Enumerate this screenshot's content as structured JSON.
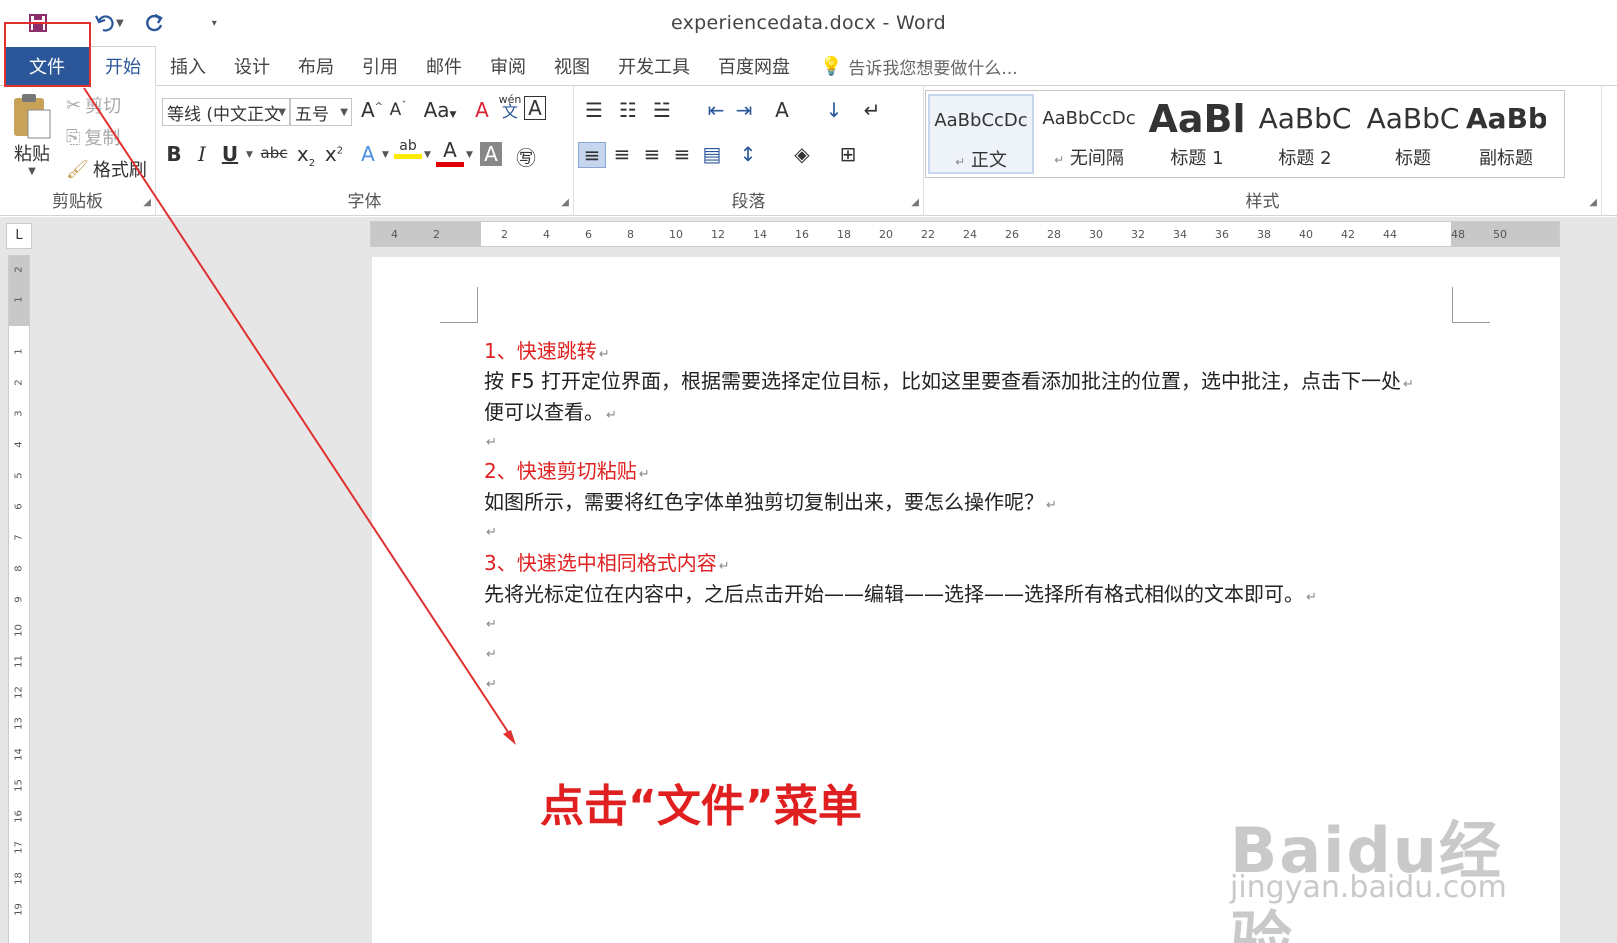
{
  "window": {
    "title": "experiencedata.docx - Word"
  },
  "qat": {
    "save_icon": "save-icon",
    "undo_icon": "undo-icon",
    "redo_icon": "redo-icon"
  },
  "tabs": [
    {
      "label": "文件"
    },
    {
      "label": "开始"
    },
    {
      "label": "插入"
    },
    {
      "label": "设计"
    },
    {
      "label": "布局"
    },
    {
      "label": "引用"
    },
    {
      "label": "邮件"
    },
    {
      "label": "审阅"
    },
    {
      "label": "视图"
    },
    {
      "label": "开发工具"
    },
    {
      "label": "百度网盘"
    }
  ],
  "tellme": {
    "placeholder": "告诉我您想要做什么..."
  },
  "clipboard": {
    "paste": "粘贴",
    "cut": "剪切",
    "copy": "复制",
    "format_painter": "格式刷",
    "label": "剪贴板"
  },
  "font": {
    "name": "等线 (中文正文",
    "size": "五号",
    "label": "字体",
    "case_label": "Aa",
    "phonetic": "wén",
    "phonetic_char": "文"
  },
  "paragraph": {
    "label": "段落"
  },
  "styles": {
    "label": "样式",
    "items": [
      {
        "sample": "AaBbCcDc",
        "name": "正文",
        "prefix": "↵"
      },
      {
        "sample": "AaBbCcDc",
        "name": "无间隔",
        "prefix": "↵"
      },
      {
        "sample": "AaBl",
        "name": "标题 1",
        "prefix": ""
      },
      {
        "sample": "AaBbC",
        "name": "标题 2",
        "prefix": ""
      },
      {
        "sample": "AaBbC",
        "name": "标题",
        "prefix": ""
      },
      {
        "sample": "AaBbC",
        "name": "副标题",
        "prefix": ""
      }
    ]
  },
  "ruler": {
    "h_ticks": [
      "4",
      "2",
      "2",
      "4",
      "6",
      "8",
      "10",
      "12",
      "14",
      "16",
      "18",
      "20",
      "22",
      "24",
      "26",
      "28",
      "30",
      "32",
      "34",
      "36",
      "38",
      "40",
      "42",
      "44",
      "48",
      "50"
    ],
    "v_ticks": [
      "2",
      "1",
      "1",
      "2",
      "3",
      "4",
      "5",
      "6",
      "7",
      "8",
      "9",
      "10",
      "11",
      "12",
      "13",
      "14",
      "15",
      "16",
      "17",
      "18",
      "19"
    ],
    "corner": "L"
  },
  "document": {
    "paragraphs": [
      {
        "text": "1、快速跳转",
        "heading": true
      },
      {
        "text": "按 F5 打开定位界面，根据需要选择定位目标，比如这里要查看添加批注的位置，选中批注，点击下一处",
        "heading": false
      },
      {
        "text": "便可以查看。",
        "heading": false
      },
      {
        "text": "",
        "heading": false
      },
      {
        "text": "2、快速剪切粘贴",
        "heading": true
      },
      {
        "text": "如图所示，需要将红色字体单独剪切复制出来，要怎么操作呢？",
        "heading": false
      },
      {
        "text": "",
        "heading": false
      },
      {
        "text": "3、快速选中相同格式内容",
        "heading": true
      },
      {
        "text": "先将光标定位在内容中，之后点击开始——编辑——选择——选择所有格式相似的文本即可。",
        "heading": false
      },
      {
        "text": "",
        "heading": false
      },
      {
        "text": "",
        "heading": false
      },
      {
        "text": "",
        "heading": false
      }
    ],
    "para_mark": "↵"
  },
  "annotation": {
    "text": "点击“文件”菜单",
    "color": "#e02020"
  },
  "watermark": {
    "logo": "Baidu经验",
    "url": "jingyan.baidu.com"
  },
  "colors": {
    "accent": "#2b579a",
    "heading": "#e02020"
  }
}
